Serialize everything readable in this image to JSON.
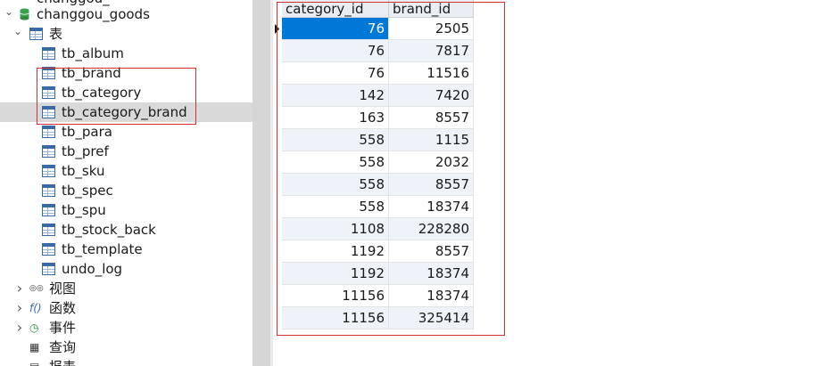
{
  "navigator": {
    "top_item_partial": "changgou_",
    "database": "changgou_goods",
    "tables_group": "表",
    "tables": [
      "tb_album",
      "tb_brand",
      "tb_category",
      "tb_category_brand",
      "tb_para",
      "tb_pref",
      "tb_sku",
      "tb_spec",
      "tb_spu",
      "tb_stock_back",
      "tb_template",
      "undo_log"
    ],
    "selected_table": "tb_category_brand",
    "other_groups": [
      "视图",
      "函数",
      "事件",
      "查询",
      "报表"
    ],
    "group_icons": [
      "glasses-icon",
      "function-icon",
      "event-clock-icon",
      "query-icon",
      "report-icon"
    ]
  },
  "grid": {
    "columns": [
      "category_id",
      "brand_id"
    ],
    "rows": [
      [
        76,
        2505
      ],
      [
        76,
        7817
      ],
      [
        76,
        11516
      ],
      [
        142,
        7420
      ],
      [
        163,
        8557
      ],
      [
        558,
        1115
      ],
      [
        558,
        2032
      ],
      [
        558,
        8557
      ],
      [
        558,
        18374
      ],
      [
        1108,
        228280
      ],
      [
        1192,
        8557
      ],
      [
        1192,
        18374
      ],
      [
        11156,
        18374
      ],
      [
        11156,
        325414
      ]
    ]
  },
  "colors": {
    "selection": "#0078d7",
    "highlight_box": "#d03030",
    "row_band": "#eef3fa"
  }
}
